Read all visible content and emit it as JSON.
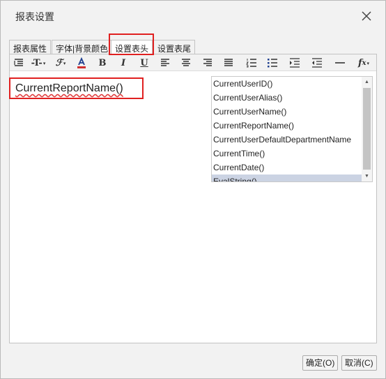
{
  "dialog": {
    "title": "报表设置",
    "close_icon": "close-icon"
  },
  "tabs": [
    {
      "label": "报表属性"
    },
    {
      "label": "字体|背景颜色"
    },
    {
      "label": "设置表头",
      "active": true
    },
    {
      "label": "设置表尾"
    }
  ],
  "toolbar": {
    "items": [
      "line-height-icon",
      "font-size-icon",
      "font-family-icon",
      "font-color-icon",
      "bold-icon",
      "italic-icon",
      "underline-icon",
      "align-left-icon",
      "align-center-icon",
      "align-right-icon",
      "align-justify-icon",
      "ordered-list-icon",
      "unordered-list-icon",
      "indent-icon",
      "outdent-icon",
      "horizontal-rule-icon",
      "function-icon"
    ]
  },
  "editor": {
    "content": "CurrentReportName()"
  },
  "function_list": {
    "items": [
      "CurrentUserID()",
      "CurrentUserAlias()",
      "CurrentUserName()",
      "CurrentReportName()",
      "CurrentUserDefaultDepartmentName",
      "CurrentTime()",
      "CurrentDate()",
      "EvalString()"
    ],
    "selected_index": 7
  },
  "buttons": {
    "ok_label": "确定(O)",
    "cancel_label": "取消(C)"
  },
  "colors": {
    "highlight": "#e02020",
    "selection": "#cbd3e3",
    "font_color_accent": "#d03030"
  }
}
